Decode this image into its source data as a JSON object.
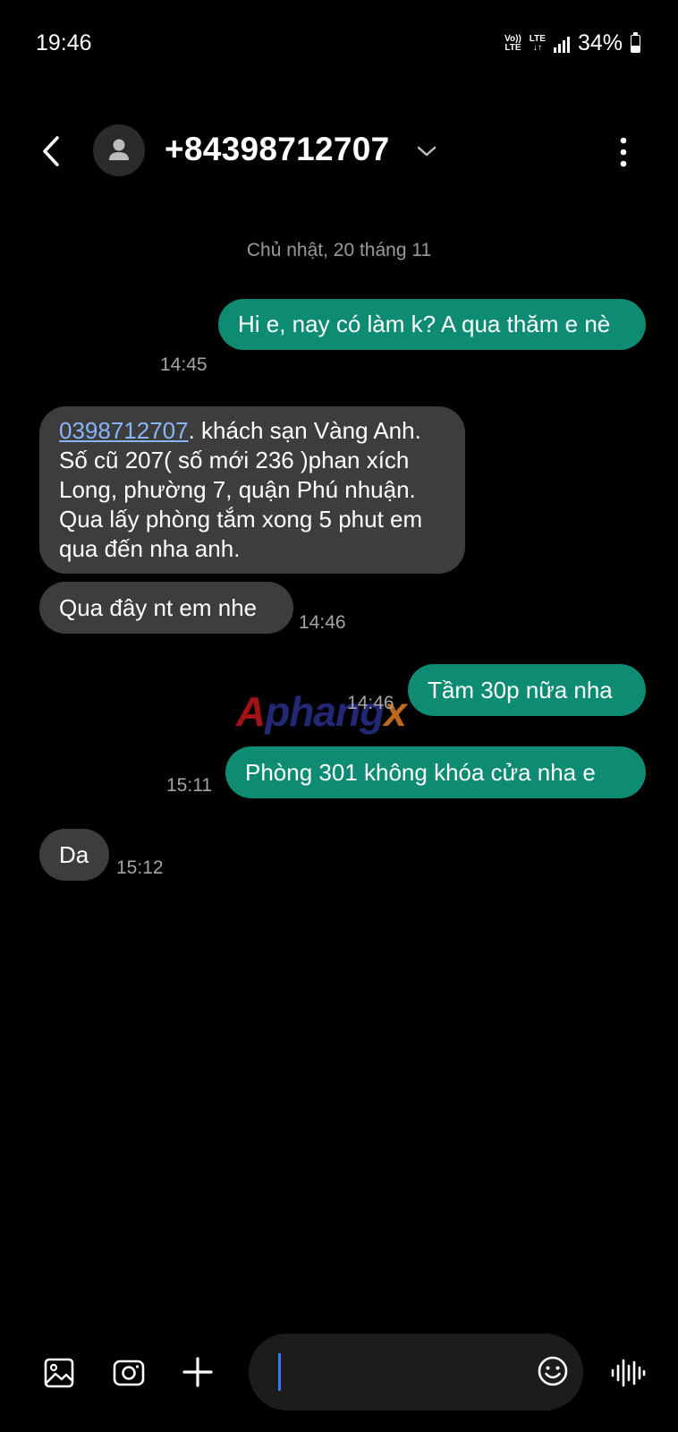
{
  "status_bar": {
    "time": "19:46",
    "volte_top": "Vo))",
    "volte_bottom": "LTE",
    "lte_top": "LTE",
    "lte_bottom": "↓↑",
    "battery_percent": "34%",
    "battery_level": 0.34
  },
  "header": {
    "contact": "+84398712707",
    "icons": {
      "back": "chevron-left-icon",
      "avatar": "person-icon",
      "expand": "chevron-down-icon",
      "more": "more-vertical-icon"
    }
  },
  "conversation": {
    "date_separator": "Chủ nhật, 20 tháng 11",
    "messages": [
      {
        "direction": "out",
        "text": "Hi e, nay có làm k? A qua thăm e nè",
        "time": "14:45"
      },
      {
        "direction": "in",
        "link": "0398712707",
        "text": ". khách sạn Vàng Anh. Số cũ 207( số mới 236 )phan xích Long, phường 7, quận Phú nhuận. Qua lấy phòng tắm xong 5 phut em qua đến nha anh.",
        "time": ""
      },
      {
        "direction": "in",
        "text": "Qua đây nt em nhe",
        "time": "14:46"
      },
      {
        "direction": "out",
        "text": "Tầm 30p nữa nha",
        "time": "14:46"
      },
      {
        "direction": "out",
        "text": "Phòng 301 không khóa cửa nha e",
        "time": "15:11"
      },
      {
        "direction": "in",
        "text": "Da",
        "time": "15:12"
      }
    ]
  },
  "watermark": {
    "part1": "A",
    "part2": "phang",
    "part3": "x"
  },
  "composer": {
    "placeholder": "",
    "value": "",
    "icons": {
      "gallery": "gallery-icon",
      "camera": "camera-icon",
      "add": "plus-icon",
      "emoji": "emoji-icon",
      "voice": "voice-wave-icon"
    }
  },
  "colors": {
    "outgoing_bubble": "#0d8c73",
    "incoming_bubble": "#3d3d3d",
    "background": "#000000",
    "link": "#8ab4f8",
    "cursor": "#2f7cf6"
  }
}
